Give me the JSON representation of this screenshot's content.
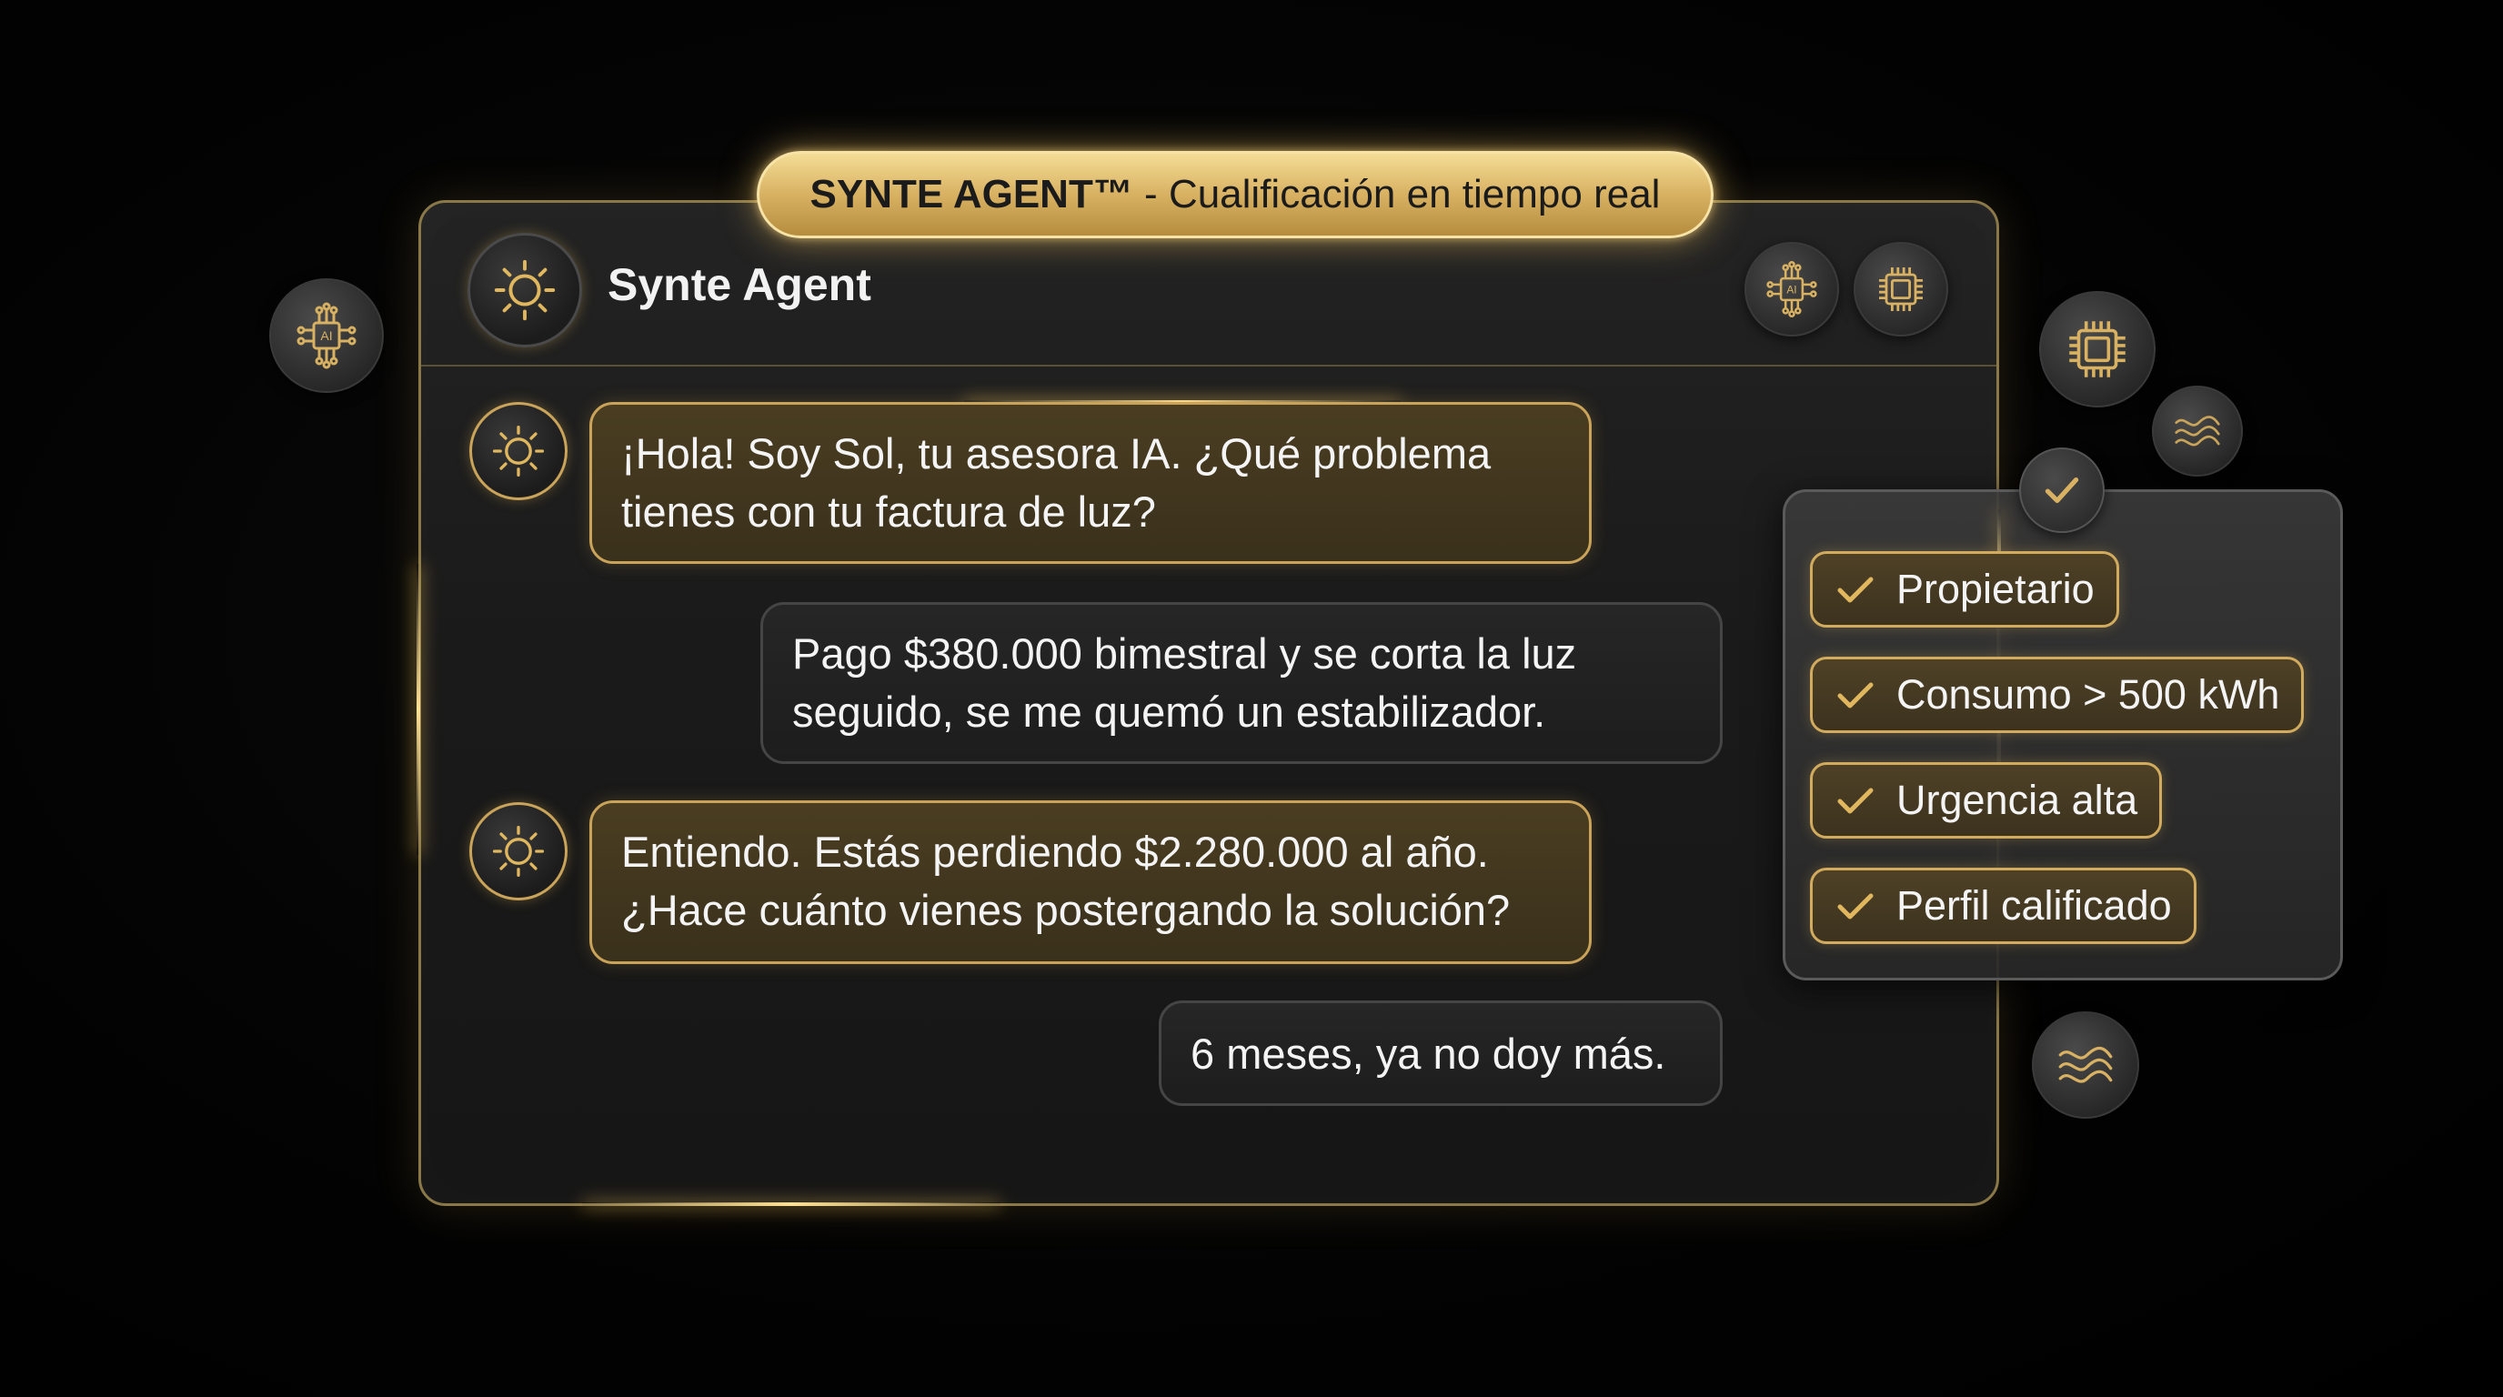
{
  "title_pill": {
    "brand": "SYNTE AGENT™",
    "separator": " - ",
    "subtitle": "Cualificación en tiempo real"
  },
  "chat": {
    "agent_name": "Synte Agent",
    "header_icons": [
      "ai-chip-icon",
      "processor-chip-icon"
    ],
    "messages": [
      {
        "sender": "agent",
        "lines": [
          "¡Hola! Soy Sol, tu asesora IA. ¿Qué problema",
          "tienes con tu factura de luz?"
        ]
      },
      {
        "sender": "user",
        "lines": [
          "Pago $380.000 bimestral y se corta la luz",
          "seguido, se me quemó un estabilizador."
        ]
      },
      {
        "sender": "agent",
        "lines": [
          "Entiendo. Estás perdiendo $2.280.000 al año.",
          "¿Hace cuánto vienes postergando la solución?"
        ]
      },
      {
        "sender": "user",
        "lines": [
          "6 meses, ya no doy más."
        ]
      }
    ]
  },
  "qualification": {
    "items": [
      {
        "label": "Propietario",
        "icon": "check-icon"
      },
      {
        "label": "Consumo > 500 kWh",
        "icon": "check-icon"
      },
      {
        "label": "Urgencia alta",
        "icon": "check-icon"
      },
      {
        "label": "Perfil calificado",
        "icon": "check-icon"
      }
    ]
  },
  "decorative_icons": [
    "ai-chip-icon",
    "processor-chip-icon",
    "wave-icon",
    "wave-icon"
  ],
  "colors": {
    "background": "#000000",
    "gold_accent": "#d8b162",
    "gold_light": "#f4dd96",
    "agent_bubble": "#3a311c",
    "user_bubble": "#1d1d1d",
    "text": "#f4f4f4"
  }
}
